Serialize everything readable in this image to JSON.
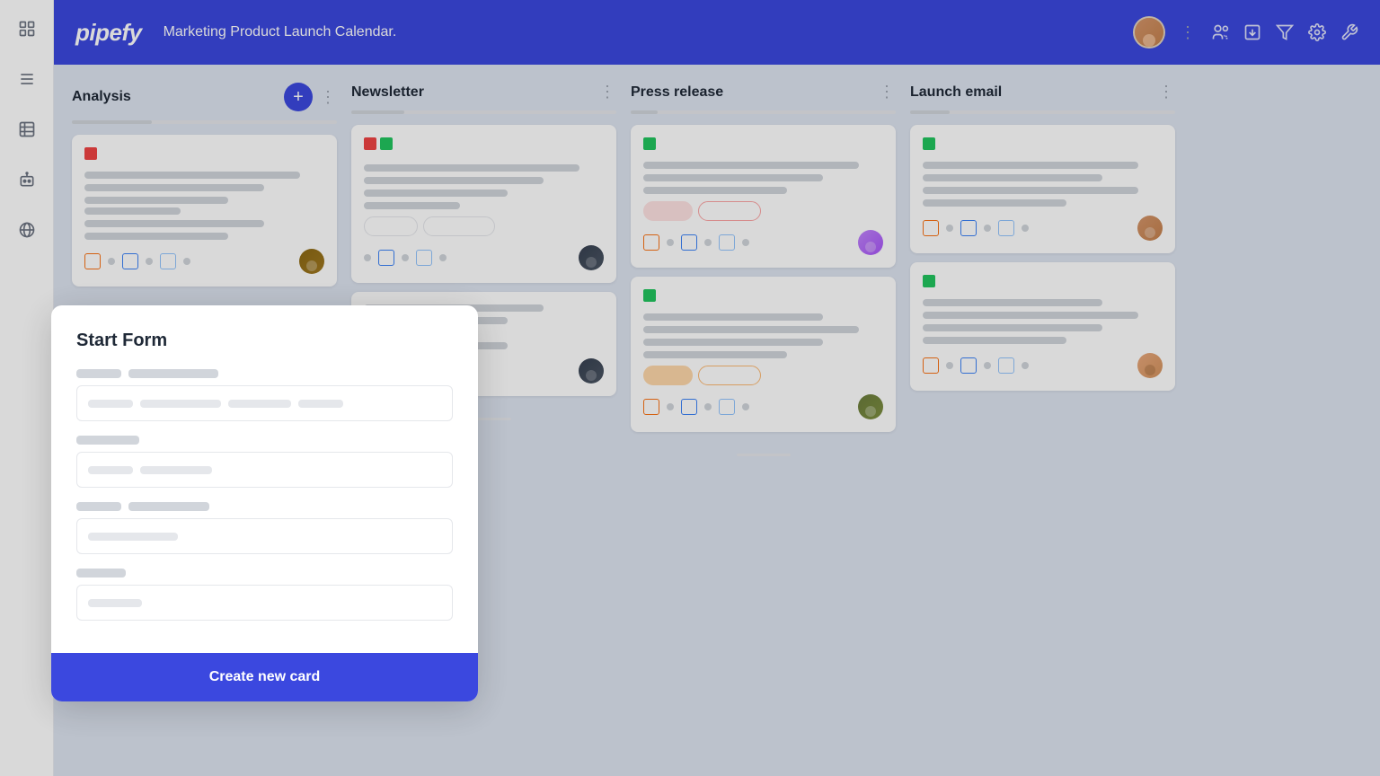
{
  "sidebar": {
    "icons": [
      {
        "name": "grid-icon",
        "symbol": "⊞"
      },
      {
        "name": "list-icon",
        "symbol": "☰"
      },
      {
        "name": "table-icon",
        "symbol": "▤"
      },
      {
        "name": "bot-icon",
        "symbol": "⊙"
      },
      {
        "name": "globe-icon",
        "symbol": "◉"
      }
    ]
  },
  "header": {
    "logo": "pipefy",
    "title": "Marketing Product Launch Calendar.",
    "user_avatar": "user-avatar"
  },
  "board": {
    "columns": [
      {
        "id": "analysis",
        "title": "Analysis",
        "has_add": true
      },
      {
        "id": "newsletter",
        "title": "Newsletter",
        "has_add": false
      },
      {
        "id": "press-release",
        "title": "Press release",
        "has_add": false
      },
      {
        "id": "launch-email",
        "title": "Launch email",
        "has_add": false
      }
    ]
  },
  "start_form": {
    "title": "Start Form",
    "field1_label1": "",
    "field1_label2": "",
    "field2_label1": "",
    "field3_label1": "",
    "field3_label2": "",
    "field4_label1": "",
    "create_button": "Create new card"
  }
}
